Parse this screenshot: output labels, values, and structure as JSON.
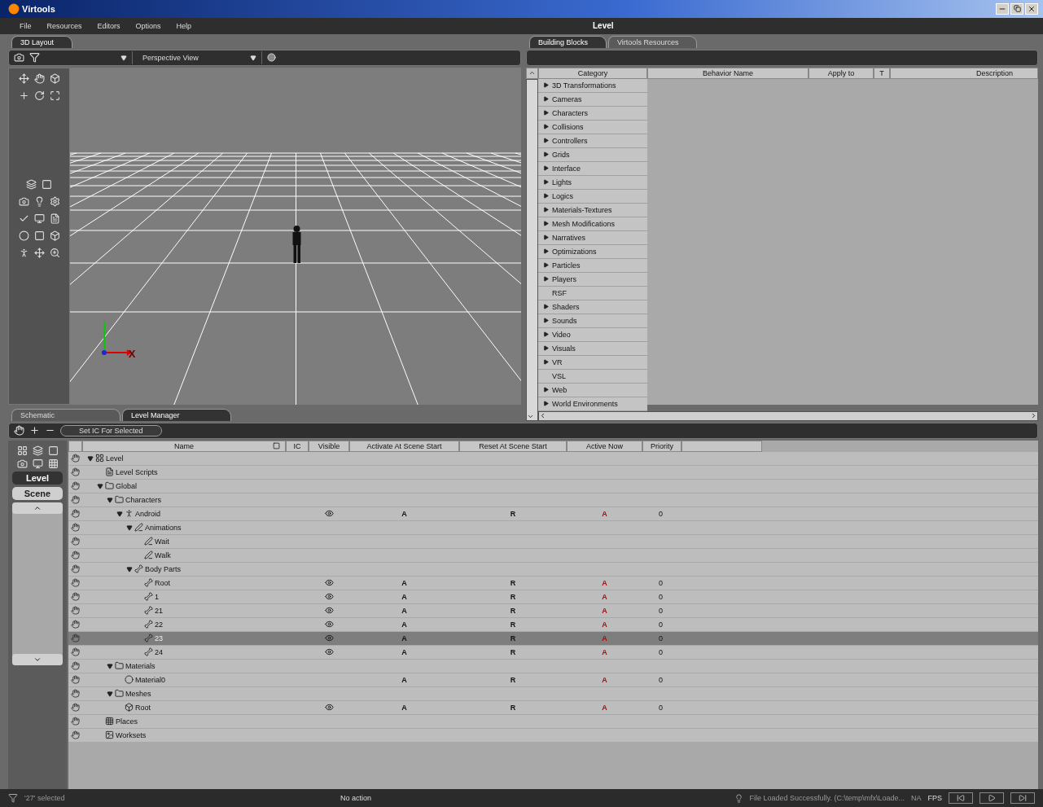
{
  "window": {
    "title": "Virtools",
    "document_title": "Level"
  },
  "menu": [
    "File",
    "Resources",
    "Editors",
    "Options",
    "Help"
  ],
  "layout_panel": {
    "tab": "3D Layout",
    "camera_view": "Perspective View",
    "axis_label": "X"
  },
  "building_blocks": {
    "tabs": [
      {
        "label": "Building Blocks",
        "selected": true
      },
      {
        "label": "Virtools Resources",
        "selected": false
      }
    ],
    "columns": [
      "Category",
      "Behavior Name",
      "Apply to",
      "T",
      "Description"
    ],
    "categories": [
      {
        "name": "3D Transformations",
        "expandable": true
      },
      {
        "name": "Cameras",
        "expandable": true
      },
      {
        "name": "Characters",
        "expandable": true
      },
      {
        "name": "Collisions",
        "expandable": true
      },
      {
        "name": "Controllers",
        "expandable": true
      },
      {
        "name": "Grids",
        "expandable": true
      },
      {
        "name": "Interface",
        "expandable": true
      },
      {
        "name": "Lights",
        "expandable": true
      },
      {
        "name": "Logics",
        "expandable": true
      },
      {
        "name": "Materials-Textures",
        "expandable": true
      },
      {
        "name": "Mesh Modifications",
        "expandable": true
      },
      {
        "name": "Narratives",
        "expandable": true
      },
      {
        "name": "Optimizations",
        "expandable": true
      },
      {
        "name": "Particles",
        "expandable": true
      },
      {
        "name": "Players",
        "expandable": true
      },
      {
        "name": "RSF",
        "expandable": false
      },
      {
        "name": "Shaders",
        "expandable": true
      },
      {
        "name": "Sounds",
        "expandable": true
      },
      {
        "name": "Video",
        "expandable": true
      },
      {
        "name": "Visuals",
        "expandable": true
      },
      {
        "name": "VR",
        "expandable": true
      },
      {
        "name": "VSL",
        "expandable": false
      },
      {
        "name": "Web",
        "expandable": true
      },
      {
        "name": "World Environments",
        "expandable": true
      }
    ]
  },
  "level_manager": {
    "tabs": [
      {
        "label": "Schematic",
        "selected": false
      },
      {
        "label": "Level Manager",
        "selected": true
      }
    ],
    "action_button": "Set IC For Selected",
    "modes": [
      {
        "label": "Level",
        "selected": true
      },
      {
        "label": "Scene",
        "selected": false
      }
    ],
    "columns": [
      "Name",
      "IC",
      "Visible",
      "Activate At Scene Start",
      "Reset At Scene Start",
      "Active Now",
      "Priority"
    ],
    "rows": [
      {
        "name": "Level",
        "kind": "level",
        "expanded": true,
        "selected": false,
        "children": [
          {
            "name": "Level Scripts",
            "kind": "script",
            "selected": false
          },
          {
            "name": "Global",
            "kind": "folder",
            "expanded": true,
            "selected": false,
            "children": [
              {
                "name": "Characters",
                "kind": "folder",
                "expanded": true,
                "selected": false,
                "children": [
                  {
                    "name": "Android",
                    "kind": "character",
                    "expanded": true,
                    "selected": false,
                    "visible": true,
                    "activate": "A",
                    "reset": "R",
                    "active": "A",
                    "priority": "0",
                    "children": [
                      {
                        "name": "Animations",
                        "kind": "animation",
                        "expanded": true,
                        "selected": false,
                        "children": [
                          {
                            "name": "Wait",
                            "kind": "animation",
                            "selected": false
                          },
                          {
                            "name": "Walk",
                            "kind": "animation",
                            "selected": false
                          }
                        ]
                      },
                      {
                        "name": "Body Parts",
                        "kind": "bone",
                        "expanded": true,
                        "selected": false,
                        "children": [
                          {
                            "name": "Root",
                            "kind": "bone",
                            "selected": false,
                            "visible": true,
                            "activate": "A",
                            "reset": "R",
                            "active": "A",
                            "priority": "0"
                          },
                          {
                            "name": "1",
                            "kind": "bone",
                            "selected": false,
                            "visible": true,
                            "activate": "A",
                            "reset": "R",
                            "active": "A",
                            "priority": "0"
                          },
                          {
                            "name": "21",
                            "kind": "bone",
                            "selected": false,
                            "visible": true,
                            "activate": "A",
                            "reset": "R",
                            "active": "A",
                            "priority": "0"
                          },
                          {
                            "name": "22",
                            "kind": "bone",
                            "selected": false,
                            "visible": true,
                            "activate": "A",
                            "reset": "R",
                            "active": "A",
                            "priority": "0"
                          },
                          {
                            "name": "23",
                            "kind": "bone",
                            "selected": true,
                            "visible": true,
                            "activate": "A",
                            "reset": "R",
                            "active": "A",
                            "priority": "0"
                          },
                          {
                            "name": "24",
                            "kind": "bone",
                            "selected": false,
                            "visible": true,
                            "activate": "A",
                            "reset": "R",
                            "active": "A",
                            "priority": "0"
                          }
                        ]
                      }
                    ]
                  }
                ]
              },
              {
                "name": "Materials",
                "kind": "folder",
                "expanded": true,
                "selected": false,
                "children": [
                  {
                    "name": "Material0",
                    "kind": "material",
                    "selected": false,
                    "visible": false,
                    "activate": "A",
                    "reset": "R",
                    "active": "A",
                    "priority": "0"
                  }
                ]
              },
              {
                "name": "Meshes",
                "kind": "folder",
                "expanded": true,
                "selected": false,
                "children": [
                  {
                    "name": "Root",
                    "kind": "mesh",
                    "selected": false,
                    "visible": true,
                    "activate": "A",
                    "reset": "R",
                    "active": "A",
                    "priority": "0"
                  }
                ]
              }
            ]
          },
          {
            "name": "Places",
            "kind": "places",
            "selected": false
          },
          {
            "name": "Worksets",
            "kind": "worksets",
            "selected": false
          }
        ]
      }
    ]
  },
  "status_bar": {
    "selection": "'27' selected",
    "action": "No action",
    "message": "File Loaded Successfully. (C:\\temp\\mfx\\Loade...",
    "mode": "NA",
    "fps_label": "FPS"
  }
}
